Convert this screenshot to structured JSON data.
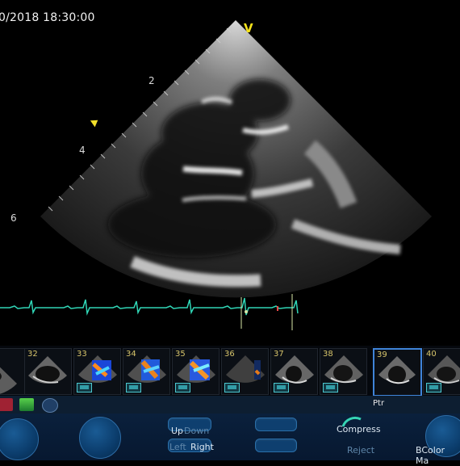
{
  "viewer": {
    "datetime": "0/2018 18:30:00",
    "orientation_marker": "V",
    "depth_labels": [
      "2",
      "4",
      "6"
    ],
    "focus_marker": "yellow-triangle"
  },
  "thumbnails": {
    "items": [
      {
        "label": "",
        "mode": "bmode"
      },
      {
        "label": "32",
        "mode": "bmode"
      },
      {
        "label": "33",
        "mode": "color"
      },
      {
        "label": "34",
        "mode": "color"
      },
      {
        "label": "35",
        "mode": "color"
      },
      {
        "label": "36",
        "mode": "color-small"
      },
      {
        "label": "37",
        "mode": "bmode"
      },
      {
        "label": "38",
        "mode": "bmode"
      },
      {
        "label": "39",
        "mode": "bmode",
        "selected": true
      },
      {
        "label": "40",
        "mode": "bmode"
      }
    ]
  },
  "toolbar": {
    "ptr_label": "Ptr",
    "icon_names": [
      "pointer-icon",
      "clip-icon",
      "circle-icon"
    ]
  },
  "controls": {
    "up_label": "Up",
    "down_label": "Down",
    "left_label": "Left",
    "right_label": "Right",
    "compress_label": "Compress",
    "reject_label": "Reject",
    "bcolor_label": "BColor Ma"
  },
  "colors": {
    "ecg": "#30d6b6",
    "accent_yellow": "#f5e21a",
    "selection_blue": "#3f84d9",
    "panel_blue": "#0d1e31"
  }
}
